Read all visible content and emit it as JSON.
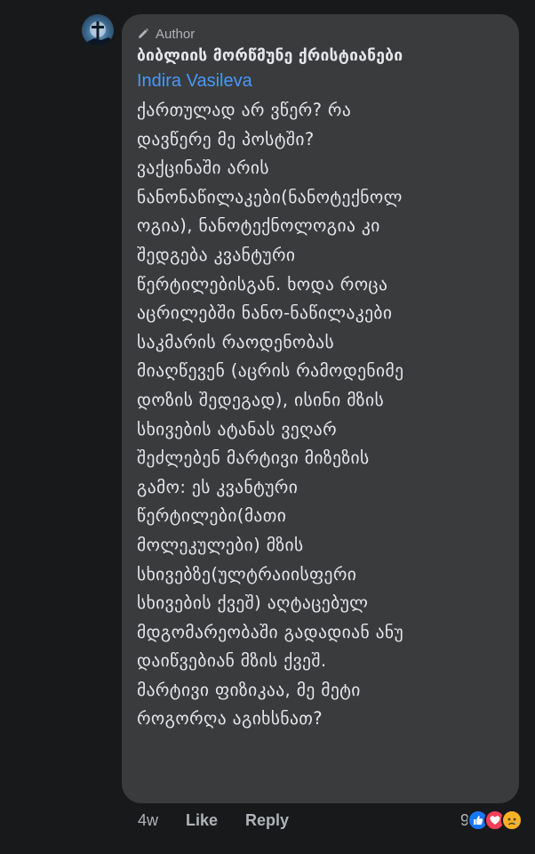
{
  "comment": {
    "author_badge": "Author",
    "group_name": "ბიბლიის მორწმუნე ქრისტიანები",
    "mention": "Indira Vasileva",
    "lines": [
      "ქართულად არ ვწერ? რა",
      "დავწერე მე პოსტში?",
      "ვაქცინაში არის",
      "ნანონაწილაკები(ნანოტექნოლ",
      "ოგია), ნანოტექნოლოგია კი",
      "შედგება კვანტური",
      "წერტილებისგან. ხოდა როცა",
      "აცრილებში ნანო-ნაწილაკები",
      "საკმარის რაოდენობას",
      "მიაღწევენ (აცრის რამოდენიმე",
      "დოზის შედეგად), ისინი მზის",
      "სხივების ატანას ვეღარ",
      "შეძლებენ მარტივი მიზეზის",
      "გამო: ეს კვანტური",
      "წერტილები(მათი",
      "მოლეკულები) მზის",
      "სხივებზე(ულტრაიისფერი",
      "სხივების ქვეშ) აღტაცებულ",
      "მდგომარეობაში გადადიან ანუ",
      "დაიწვებიან მზის ქვეშ.",
      "მარტივი ფიზიკაა, მე მეტი",
      "როგორღა აგიხსნათ?"
    ]
  },
  "actions": {
    "time": "4w",
    "like": "Like",
    "reply": "Reply"
  },
  "reactions": {
    "count": "9",
    "types": [
      "like-reaction",
      "love-reaction",
      "sad-reaction"
    ]
  },
  "colors": {
    "background": "#18191a",
    "bubble": "#3a3b3c",
    "text": "#e4e6eb",
    "secondary": "#b0b3b8",
    "mention": "#4599ff"
  }
}
